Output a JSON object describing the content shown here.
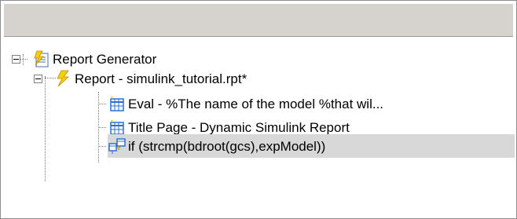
{
  "tree": {
    "items": [
      {
        "label": "Report Generator",
        "icon": "report-generator-icon"
      },
      {
        "label": "Report - simulink_tutorial.rpt*",
        "icon": "lightning-icon"
      },
      {
        "label": "Eval - %The name of the model %that wil...",
        "icon": "table-component-icon"
      },
      {
        "label": "Title Page - Dynamic Simulink Report",
        "icon": "table-component-icon"
      },
      {
        "label": "if (strcmp(bdroot(gcs),expModel))",
        "icon": "logic-if-icon"
      }
    ],
    "selected_index": 4
  },
  "colors": {
    "header_bg": "#d6d3ce",
    "selected_bg": "#d8d8d8",
    "lightning_yellow": "#f6d000",
    "table_blue": "#2a6fd6"
  }
}
